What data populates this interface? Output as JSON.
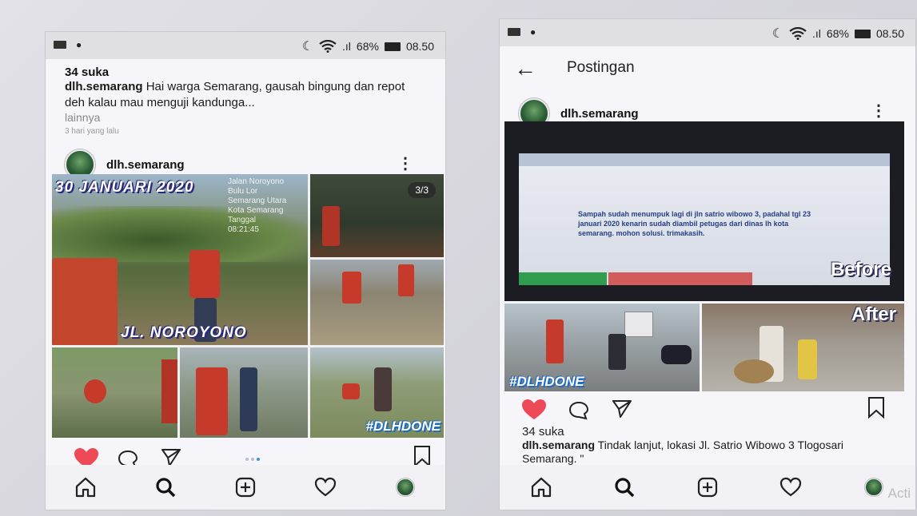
{
  "status": {
    "left_icons": [
      "image-icon",
      "location-icon"
    ],
    "signal_text": ".ıl",
    "battery": "68%",
    "time": "08.50"
  },
  "left": {
    "top_post": {
      "likes": "34 suka",
      "username": "dlh.semarang",
      "caption": "Hai warga Semarang, gausah bingung dan repot deh kalau mau menguji kandunga...",
      "more": "lainnya",
      "timestamp": "3 hari yang lalu"
    },
    "post": {
      "username": "dlh.semarang",
      "date_title": "30 JANUARI 2020",
      "location_title": "JL. NOROYONO",
      "hashtag": "#DLHDONE",
      "counter": "3/3",
      "carousel_total": 3,
      "carousel_active": 3,
      "faded_text_lines": [
        "Jalan Noroyono",
        "Bulu Lor",
        "Semarang Utara",
        "Kota Semarang",
        "Tanggal",
        "08:21:45"
      ]
    }
  },
  "right": {
    "appbar_title": "Postingan",
    "post": {
      "username": "dlh.semarang",
      "complaint_text": "Sampah sudah menumpuk lagi di jln satrio wibowo 3, padahal tgl 23 januari 2020 kenarin sudah diambil petugas dari dinas lh kota semarang. mohon solusi. trimakasih.",
      "before_label": "Before",
      "after_label": "After",
      "hashtag": "#DLHDONE",
      "likes": "34 suka",
      "caption_user": "dlh.semarang",
      "caption": "Tindak lanjut, lokasi Jl. Satrio Wibowo 3 Tlogosari Semarang. \""
    }
  },
  "nav": [
    "home-icon",
    "search-icon",
    "add-icon",
    "heart-icon",
    "profile-icon"
  ],
  "watermark": "Acti",
  "colors": {
    "like_red": "#ed4956",
    "overlay_blue": "#2a2a7a",
    "hashtag_blue": "#1b6bc9",
    "active_dot": "#3c8ee6"
  }
}
